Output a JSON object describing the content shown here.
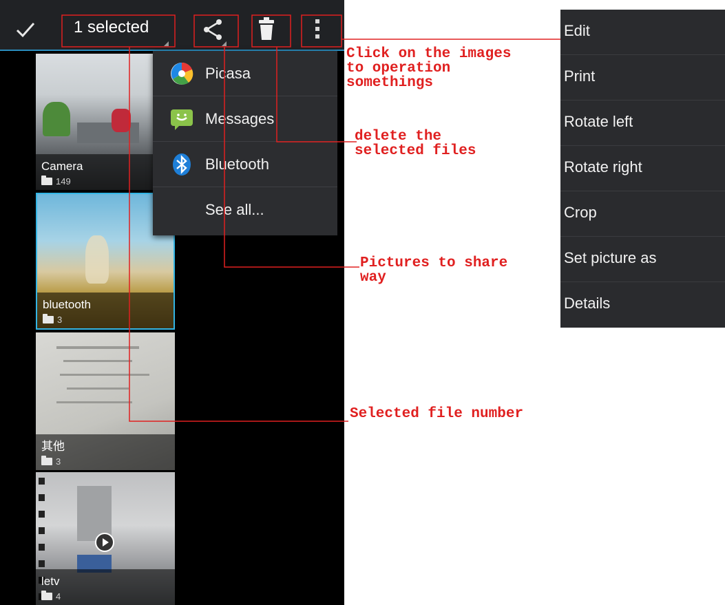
{
  "action_bar": {
    "selected_label": "1 selected",
    "icons": [
      "check-icon",
      "share-icon",
      "trash-icon",
      "overflow-icon"
    ]
  },
  "albums": [
    {
      "name": "Camera",
      "count": "149"
    },
    {
      "name": "bluetooth",
      "count": "3"
    },
    {
      "name": "其他",
      "count": "3"
    },
    {
      "name": "letv",
      "count": "4"
    }
  ],
  "share_menu": {
    "items": [
      {
        "label": "Picasa",
        "icon": "picasa-icon"
      },
      {
        "label": "Messages",
        "icon": "messages-icon"
      },
      {
        "label": "Bluetooth",
        "icon": "bluetooth-icon"
      },
      {
        "label": "See all...",
        "icon": ""
      }
    ]
  },
  "overflow_menu": {
    "items": [
      "Edit",
      "Print",
      "Rotate left",
      "Rotate right",
      "Crop",
      "Set picture as",
      "Details"
    ]
  },
  "annotations": {
    "operation": "Click on the images\nto operation\nsomethings",
    "delete": "delete the\nselected files",
    "share": "Pictures to share\nway",
    "selected": "Selected file number"
  },
  "colors": {
    "annotation": "#e02020",
    "accent": "#2a8dbe",
    "menu_bg": "#2a2b2e"
  }
}
